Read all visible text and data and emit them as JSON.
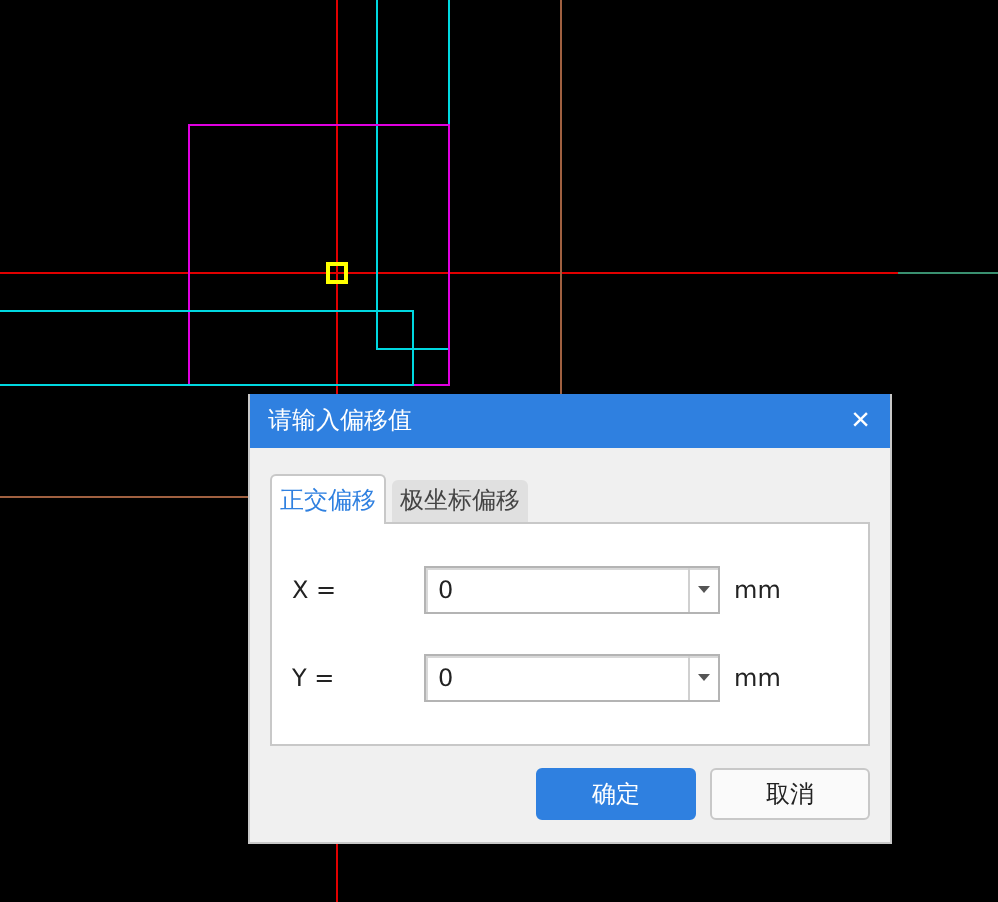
{
  "dialog": {
    "title": "请输入偏移值",
    "close": "×",
    "tabs": [
      {
        "label": "正交偏移",
        "selected": true
      },
      {
        "label": "极坐标偏移",
        "selected": false
      }
    ],
    "fields": [
      {
        "label": "X =",
        "value": "0",
        "unit": "mm"
      },
      {
        "label": "Y =",
        "value": "0",
        "unit": "mm"
      }
    ],
    "buttons": [
      {
        "label": "确定",
        "kind": "primary"
      },
      {
        "label": "取消",
        "kind": "secondary"
      }
    ]
  }
}
